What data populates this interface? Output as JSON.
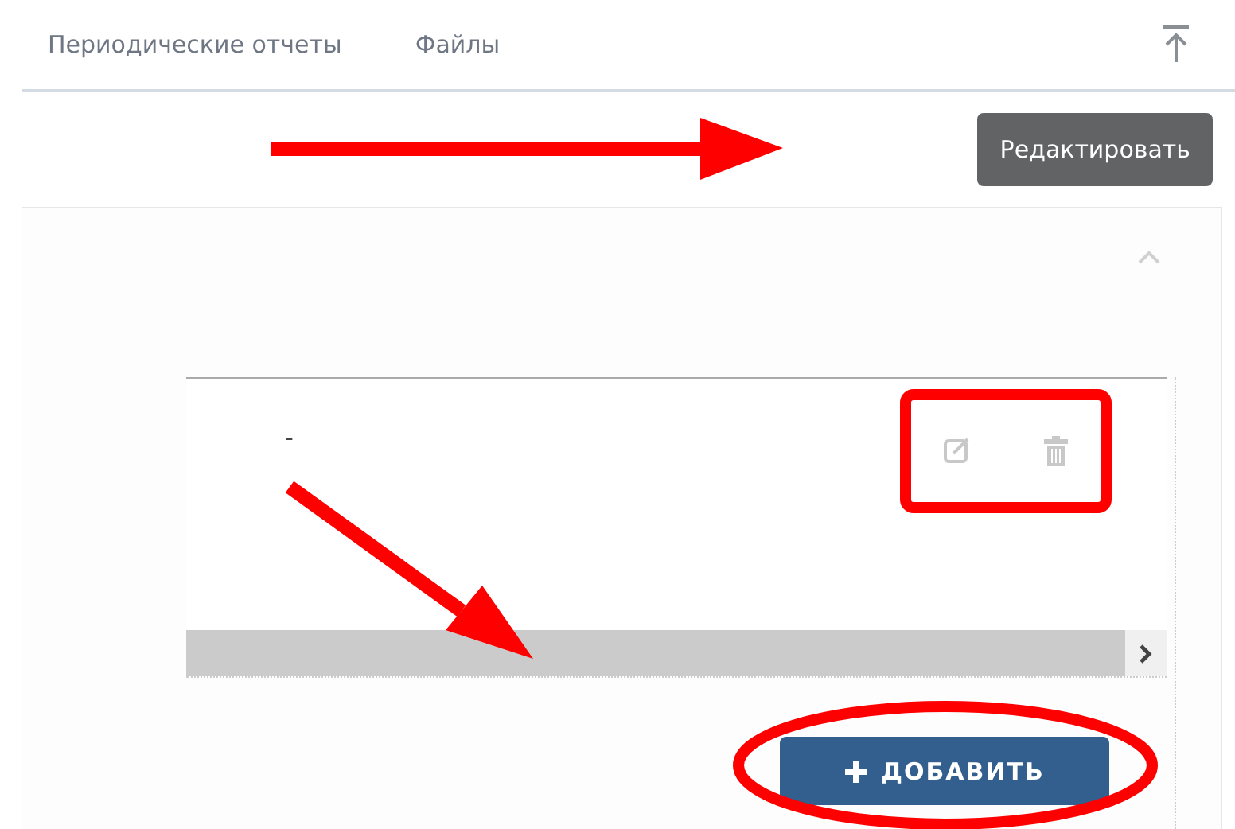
{
  "tabs": [
    {
      "label": "Периодические отчеты"
    },
    {
      "label": "Файлы"
    }
  ],
  "edit_button": {
    "label": "Редактировать"
  },
  "panel": {
    "expanded": true
  },
  "table": {
    "rows": [
      {
        "cells": [
          "-"
        ]
      }
    ]
  },
  "add_button": {
    "label": "ДОБАВИТЬ"
  }
}
